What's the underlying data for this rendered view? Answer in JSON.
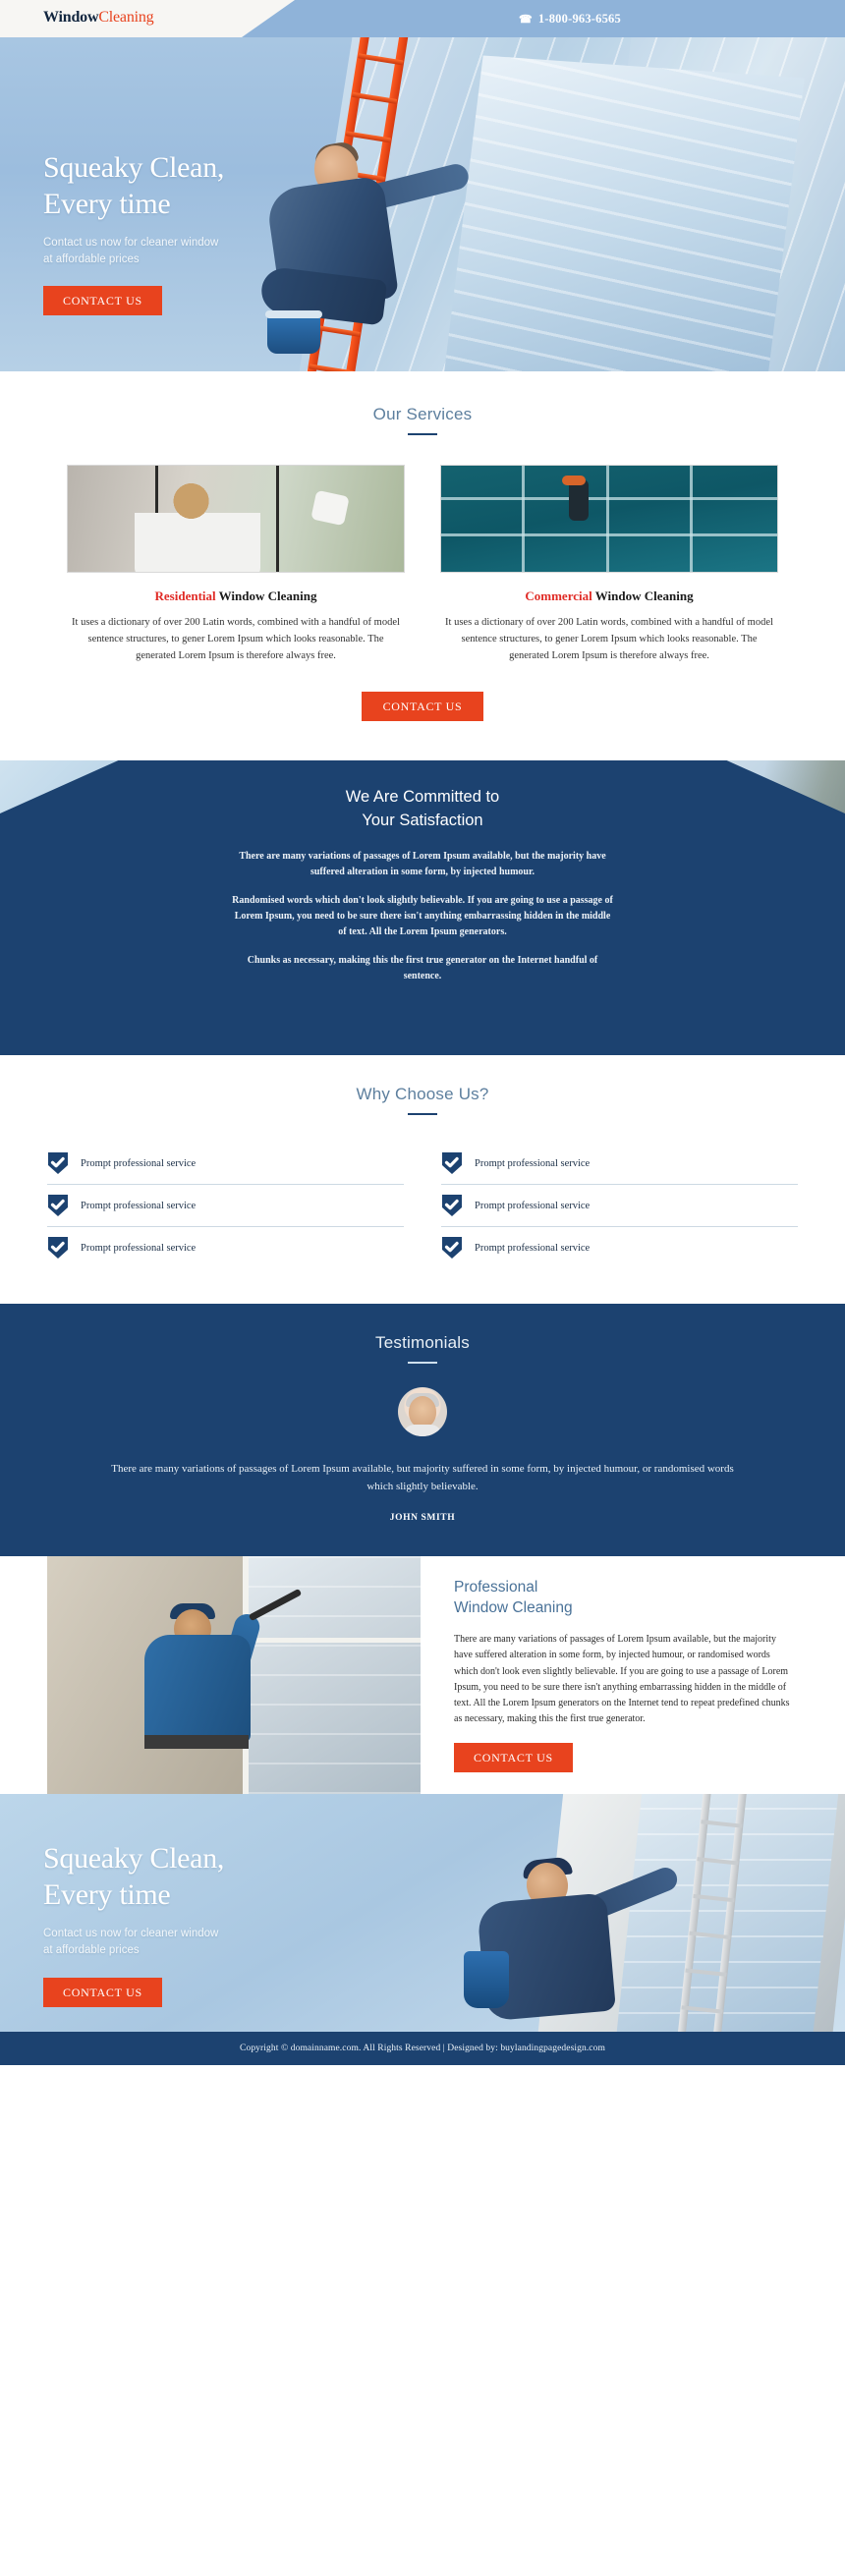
{
  "header": {
    "logo_primary": "Window",
    "logo_secondary": "Cleaning",
    "phone_icon": "phone-icon",
    "phone": "1-800-963-6565"
  },
  "hero": {
    "title_line1": "Squeaky Clean,",
    "title_line2": "Every time",
    "subtitle_line1": "Contact us now for cleaner window",
    "subtitle_line2": "at affordable prices",
    "cta_label": "CONTACT US"
  },
  "services": {
    "title": "Our Services",
    "cta_label": "CONTACT US",
    "cards": [
      {
        "accent": "Residential",
        "rest": " Window Cleaning",
        "text": "It uses a dictionary of over 200 Latin words, combined with a handful of model sentence structures, to gener Lorem Ipsum which looks reasonable. The generated Lorem Ipsum is therefore always free.",
        "image_name": "residential-window-cleaning-photo"
      },
      {
        "accent": "Commercial",
        "rest": " Window Cleaning",
        "text": "It uses a dictionary of over 200 Latin words, combined with a handful of model sentence structures, to gener Lorem Ipsum which looks reasonable. The generated Lorem Ipsum is therefore always free.",
        "image_name": "commercial-window-cleaning-photo"
      }
    ]
  },
  "committed": {
    "title_line1": "We Are Committed to",
    "title_line2": "Your Satisfaction",
    "paragraphs": [
      "There are many variations of passages of Lorem Ipsum available, but the majority have suffered alteration in some form, by injected humour.",
      "Randomised words which don't look slightly believable. If you are going to use a passage of Lorem Ipsum, you need to be sure there isn't anything embarrassing hidden in the middle of text. All the Lorem Ipsum generators.",
      "Chunks as necessary, making this the first true generator on the Internet handful of sentence."
    ]
  },
  "why": {
    "title": "Why Choose Us?",
    "left_items": [
      "Prompt professional service",
      "Prompt professional service",
      "Prompt professional service"
    ],
    "right_items": [
      "Prompt professional service",
      "Prompt professional service",
      "Prompt professional service"
    ]
  },
  "testimonials": {
    "title": "Testimonials",
    "quote": "There are many variations of passages of Lorem Ipsum available, but majority suffered in some form, by injected humour, or randomised words which slightly believable.",
    "author": "JOHN SMITH"
  },
  "professional": {
    "title_line1": "Professional",
    "title_line2": "Window Cleaning",
    "body": "There are many variations of passages of Lorem Ipsum available, but the majority have suffered alteration in some form, by injected humour, or randomised words which don't look even slightly believable. If you are going to use a passage of Lorem Ipsum, you need to be sure there isn't anything embarrassing hidden in the middle of text. All the Lorem Ipsum generators on the Internet tend to repeat predefined chunks as necessary, making this the first true generator.",
    "cta_label": "CONTACT US"
  },
  "hero_bottom": {
    "title_line1": "Squeaky Clean,",
    "title_line2": "Every time",
    "subtitle_line1": "Contact us now for cleaner window",
    "subtitle_line2": "at affordable prices",
    "cta_label": "CONTACT US"
  },
  "footer": {
    "text": "Copyright © domainname.com. All Rights Reserved | Designed by: buylandingpagedesign.com"
  },
  "colors": {
    "navy": "#1c4270",
    "orange": "#e8431e",
    "sky": "#9cbdde",
    "accent_red": "#e02b26",
    "muted_blue": "#5d7f9e"
  }
}
